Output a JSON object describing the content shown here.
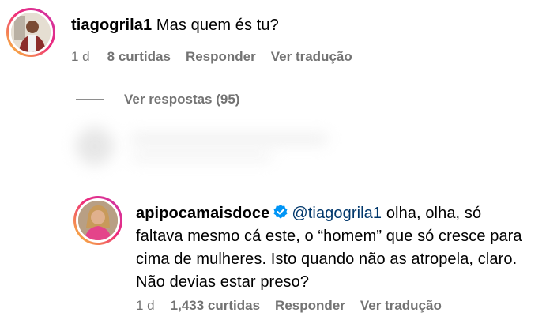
{
  "comment1": {
    "username": "tiagogrila1",
    "text": "Mas quem és tu?",
    "time": "1 d",
    "likes": "8 curtidas",
    "reply": "Responder",
    "translate": "Ver tradução"
  },
  "replies_toggle": "Ver respostas (95)",
  "comment2": {
    "username": "apipocamaisdoce",
    "mention": "@tiagogrila1",
    "text_line1": "olha, olha, só",
    "text_line2": "faltava mesmo cá este, o “homem” que só cresce para",
    "text_line3": "cima de mulheres. Isto quando não as atropela, claro.",
    "text_line4": "Não devias estar preso?",
    "time": "1 d",
    "likes": "1,433 curtidas",
    "reply": "Responder",
    "translate": "Ver tradução"
  },
  "colors": {
    "meta_gray": "#737373",
    "mention_blue": "#00376b",
    "verified_blue": "#0095f6"
  }
}
